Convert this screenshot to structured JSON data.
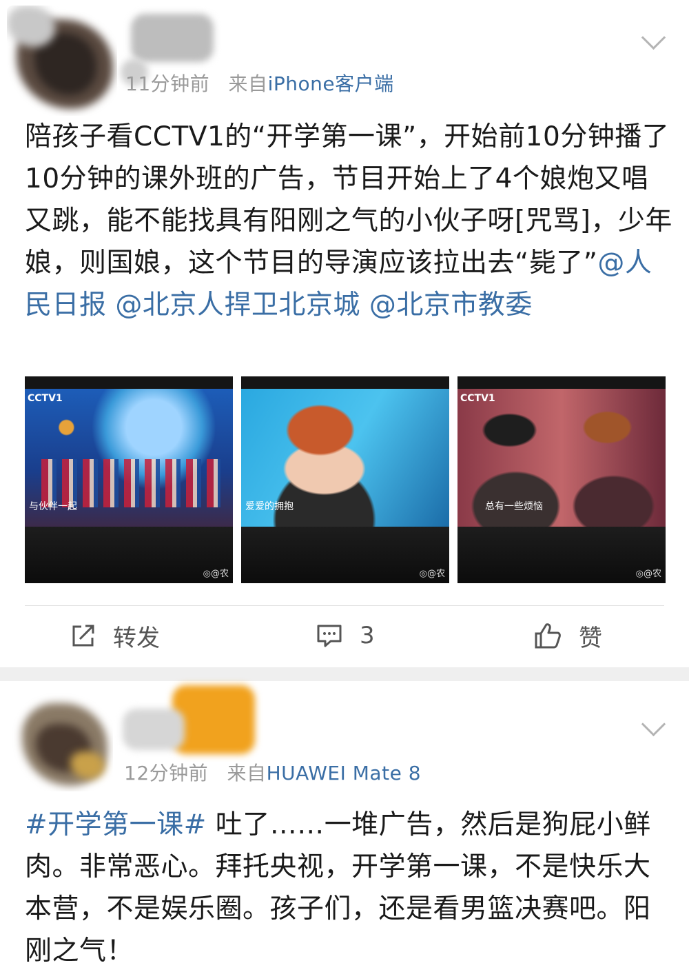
{
  "post1": {
    "time": "11分钟前",
    "source_prefix": "来自",
    "source": "iPhone客户端",
    "text": "陪孩子看CCTV1的“开学第一课”，开始前10分钟播了10分钟的课外班的广告，节目开始上了4个娘炮又唱又跳，能不能找具有阳刚之气的小伙子呀[咒骂]，少年娘，则国娘，这个节目的导演应该拉出去“毙了”",
    "mentions": [
      "@人民日报",
      "@北京人捍卫北京城",
      "@北京市教委"
    ],
    "images": [
      {
        "logo": "CCTV1",
        "caption": "与伙伴一起",
        "watermark": "@农"
      },
      {
        "logo": "",
        "caption": "爱爱的拥抱",
        "watermark": "@农"
      },
      {
        "logo": "CCTV1",
        "caption": "总有一些烦恼",
        "watermark": "@农"
      }
    ],
    "actions": {
      "repost_label": "转发",
      "comment_count": "3",
      "like_label": "赞"
    }
  },
  "post2": {
    "time": "12分钟前",
    "source_prefix": "来自",
    "source": "HUAWEI Mate 8",
    "hashtag": "#开学第一课#",
    "text": " 吐了……一堆广告，然后是狗屁小鲜肉。非常恶心。拜托央视，开学第一课，不是快乐大本营，不是娱乐圈。孩子们，还是看男篮决赛吧。阳刚之气！"
  },
  "icons": [
    "chevron-down-icon",
    "repost-icon",
    "comment-icon",
    "like-icon",
    "weibo-icon"
  ],
  "colors": {
    "link": "#3a6ea5",
    "meta": "#9a9a9a",
    "separator": "#efefef"
  }
}
